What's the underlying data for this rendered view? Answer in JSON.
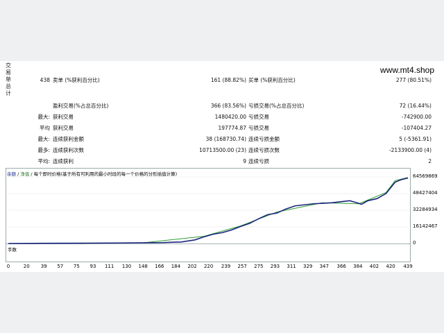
{
  "watermark": "www.mt4.shop",
  "side_label": [
    "交",
    "易",
    "单",
    "总",
    "计"
  ],
  "stats": {
    "row1": {
      "count": "438",
      "sell_label": "卖单 (%获利百分比)",
      "sell_value": "161 (88.82%)",
      "buy_label": "买单 (%获利百分比)",
      "buy_value": "277 (80.51%)"
    },
    "row2": {
      "win_label": "盈利交易(%占总百分比)",
      "win_value": "366 (83.56%)",
      "loss_label": "亏损交易(%占总百分比)",
      "loss_value": "72 (16.44%)"
    },
    "row3": {
      "prefix": "最大:",
      "win_label": "获利交易",
      "win_value": "1480420.00",
      "loss_label": "亏损交易",
      "loss_value": "-742900.00"
    },
    "row4": {
      "prefix": "平均",
      "win_label": "获利交易",
      "win_value": "197774.87",
      "loss_label": "亏损交易",
      "loss_value": "-107404.27"
    },
    "row5": {
      "prefix": "最大:",
      "win_label": "连续获利金额",
      "win_value": "38 (168730.74)",
      "loss_label": "连续亏损金额",
      "loss_value": "5 (-5361.91)"
    },
    "row6": {
      "prefix": "最多:",
      "win_label": "连续获利次数",
      "win_value": "10713500.00 (23)",
      "loss_label": "连续亏损次数",
      "loss_value": "-2133900.00 (4)"
    },
    "row7": {
      "prefix": "平均:",
      "win_label": "连续获利",
      "win_value": "9",
      "loss_label": "连续亏损",
      "loss_value": "2"
    }
  },
  "chart_header": {
    "balance": "余额",
    "sep1": " / ",
    "equity": "净值",
    "rest": " / 每个即时价格(基于所有可利用的最小时段的每一个价格的分形插值计算)"
  },
  "volume_label": "手数",
  "chart_data": {
    "type": "line",
    "x_ticks": [
      "0",
      "20",
      "39",
      "57",
      "75",
      "93",
      "111",
      "130",
      "148",
      "166",
      "184",
      "202",
      "220",
      "239",
      "257",
      "275",
      "293",
      "311",
      "329",
      "347",
      "366",
      "384",
      "402",
      "420",
      "439"
    ],
    "y_ticks": [
      "64569869",
      "48427404",
      "32284934",
      "16142467",
      "0"
    ],
    "ylim": [
      0,
      64569869
    ],
    "xlim": [
      0,
      439
    ],
    "series": [
      {
        "name": "余额",
        "color": "#1a237e",
        "x": [
          0,
          40,
          80,
          120,
          148,
          170,
          190,
          205,
          215,
          225,
          235,
          245,
          255,
          265,
          275,
          285,
          295,
          305,
          315,
          325,
          335,
          345,
          355,
          365,
          375,
          383,
          388,
          395,
          405,
          415,
          425,
          432,
          439
        ],
        "y": [
          0,
          200000,
          300000,
          500000,
          700000,
          900000,
          1500000,
          3500000,
          6500000,
          9000000,
          10500000,
          13000000,
          16500000,
          19500000,
          24000000,
          28000000,
          29500000,
          33500000,
          36500000,
          37500000,
          38500000,
          39000000,
          39500000,
          40500000,
          41500000,
          39500000,
          38000000,
          41500000,
          43500000,
          48500000,
          59500000,
          62000000,
          63500000
        ]
      },
      {
        "name": "净值",
        "color": "#2e9e2e",
        "x": [
          0,
          148,
          215,
          255,
          295,
          345,
          385,
          415,
          425,
          439
        ],
        "y": [
          0,
          700000,
          7000000,
          17000000,
          30500000,
          39500000,
          38500000,
          49500000,
          61000000,
          64000000
        ]
      }
    ],
    "volume": {
      "color": "#3cb83c",
      "start_index": 175,
      "full_index": 235,
      "max": 1
    }
  }
}
